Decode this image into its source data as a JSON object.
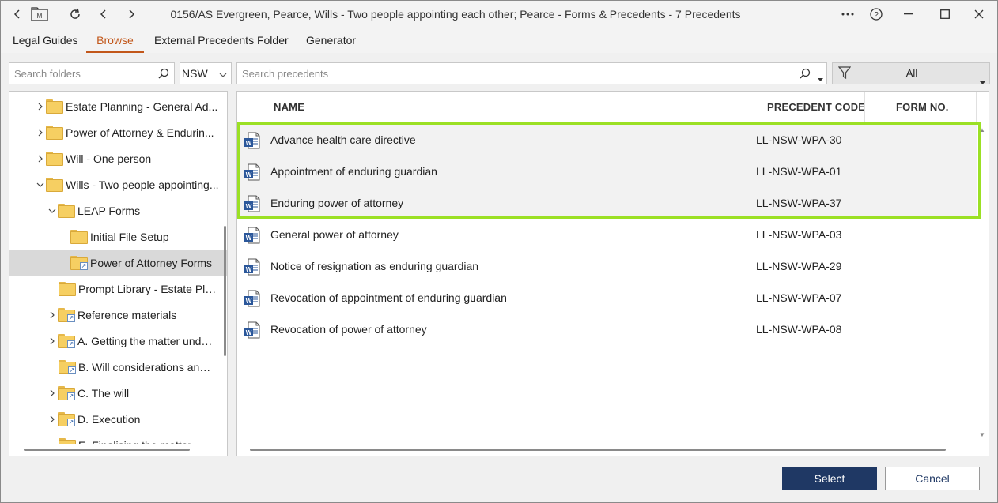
{
  "window": {
    "title": "0156/AS Evergreen, Pearce, Wills - Two people appointing each other; Pearce - Forms & Precedents - 7 Precedents"
  },
  "tabs": [
    {
      "label": "Legal Guides"
    },
    {
      "label": "Browse"
    },
    {
      "label": "External Precedents Folder"
    },
    {
      "label": "Generator"
    }
  ],
  "folder_search": {
    "placeholder": "Search folders"
  },
  "state_select": {
    "value": "NSW"
  },
  "precedent_search": {
    "placeholder": "Search precedents"
  },
  "filter": {
    "value": "All"
  },
  "tree": {
    "items": [
      {
        "label": "Estate Planning - General Ad..."
      },
      {
        "label": "Power of Attorney & Endurin..."
      },
      {
        "label": "Will - One person"
      },
      {
        "label": "Wills - Two people appointing..."
      },
      {
        "label": "LEAP Forms"
      },
      {
        "label": "Initial File Setup"
      },
      {
        "label": "Power of Attorney Forms"
      },
      {
        "label": "Prompt Library - Estate Pla..."
      },
      {
        "label": "Reference materials"
      },
      {
        "label": "A. Getting the matter unde..."
      },
      {
        "label": "B. Will considerations and ..."
      },
      {
        "label": "C. The will"
      },
      {
        "label": "D. Execution"
      },
      {
        "label": "E. Finalising the matter"
      }
    ]
  },
  "grid": {
    "columns": {
      "name": "NAME",
      "code": "PRECEDENT CODE",
      "form": "FORM NO."
    },
    "rows": [
      {
        "name": "Advance health care directive",
        "code": "LL-NSW-WPA-30"
      },
      {
        "name": "Appointment of enduring guardian",
        "code": "LL-NSW-WPA-01"
      },
      {
        "name": "Enduring power of attorney",
        "code": "LL-NSW-WPA-37"
      },
      {
        "name": "General power of attorney",
        "code": "LL-NSW-WPA-03"
      },
      {
        "name": "Notice of resignation as enduring guardian",
        "code": "LL-NSW-WPA-29"
      },
      {
        "name": "Revocation of appointment of enduring guardian",
        "code": "LL-NSW-WPA-07"
      },
      {
        "name": "Revocation of power of attorney",
        "code": "LL-NSW-WPA-08"
      }
    ]
  },
  "buttons": {
    "select": "Select",
    "cancel": "Cancel"
  },
  "colors": {
    "accent_tab": "#c2571a",
    "primary_button": "#1f3864",
    "highlight": "#9be024"
  }
}
